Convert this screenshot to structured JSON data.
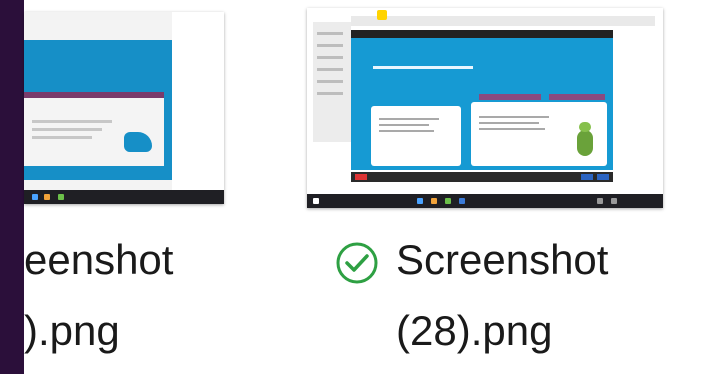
{
  "files": [
    {
      "name_line1": "eenshot",
      "name_line2": ").png",
      "status_icon": "none",
      "thumbnail_icon": "presentation-thumbnail-icon"
    },
    {
      "name_line1": "Screenshot",
      "name_line2": "(28).png",
      "status_icon": "check-circle-icon",
      "thumbnail_icon": "presentation-thumbnail-icon"
    }
  ],
  "colors": {
    "sidebar": "#2b0f3a",
    "slide_blue": "#169ad3",
    "accent_purple": "#8a4a7f",
    "check_green": "#2ea043"
  }
}
